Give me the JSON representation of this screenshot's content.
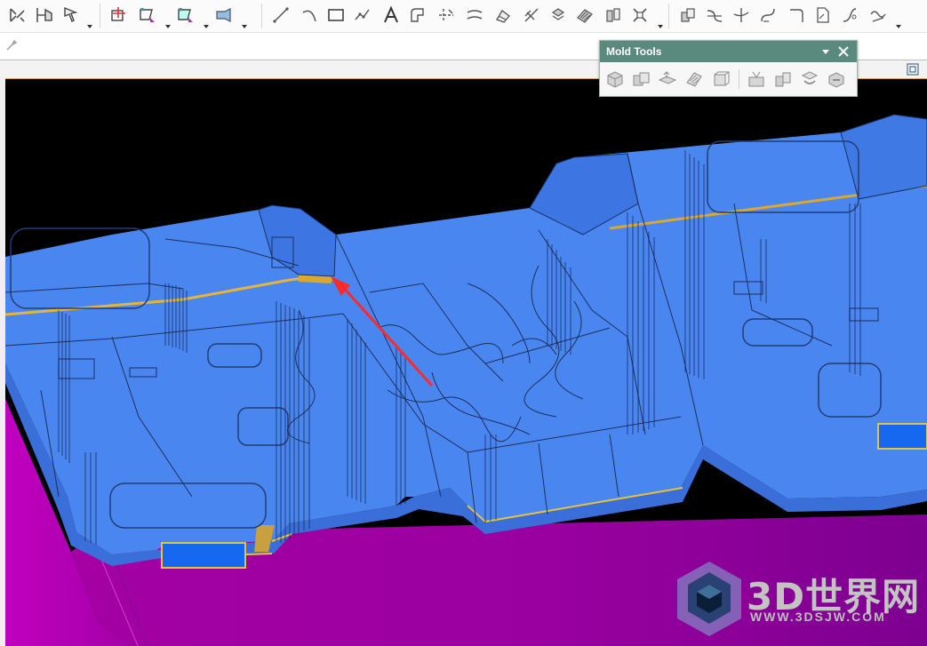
{
  "toolbar": {
    "groups": [
      [
        "constraint-icon",
        "dimension-icon",
        "select-icon"
      ],
      [
        "sketch-icon",
        "selection-filter-icon",
        "pick-icon",
        "view-icon"
      ],
      [
        "line-icon",
        "arc-icon",
        "rectangle-icon",
        "spline-icon",
        "text-icon",
        "offset-icon",
        "trim-icon",
        "extend-icon",
        "fillet-icon",
        "chamfer-icon",
        "mirror-icon",
        "pattern-icon",
        "project-icon",
        "transform-icon"
      ],
      [
        "curve-icon",
        "bridge-icon",
        "intersect-icon",
        "blend-icon",
        "corner-icon",
        "sheet-icon",
        "helix-icon",
        "wave-icon"
      ]
    ]
  },
  "mold_tools": {
    "title": "Mold Tools",
    "tools": [
      "box-icon",
      "split-solid-icon",
      "patch-icon",
      "surface-patch-icon",
      "block-icon",
      "trim-region-icon",
      "replace-solid-icon",
      "extend-solid-icon",
      "subtract-icon"
    ]
  },
  "viewport": {
    "background": "#000000",
    "part_color": "#4a86f0",
    "side_color": "#a300a3",
    "highlight_color": "#d9b23a",
    "arrow_color": "#ff2a2a"
  },
  "watermark": {
    "brand": "3D世界网",
    "url": "WWW.3DSJW.COM"
  }
}
